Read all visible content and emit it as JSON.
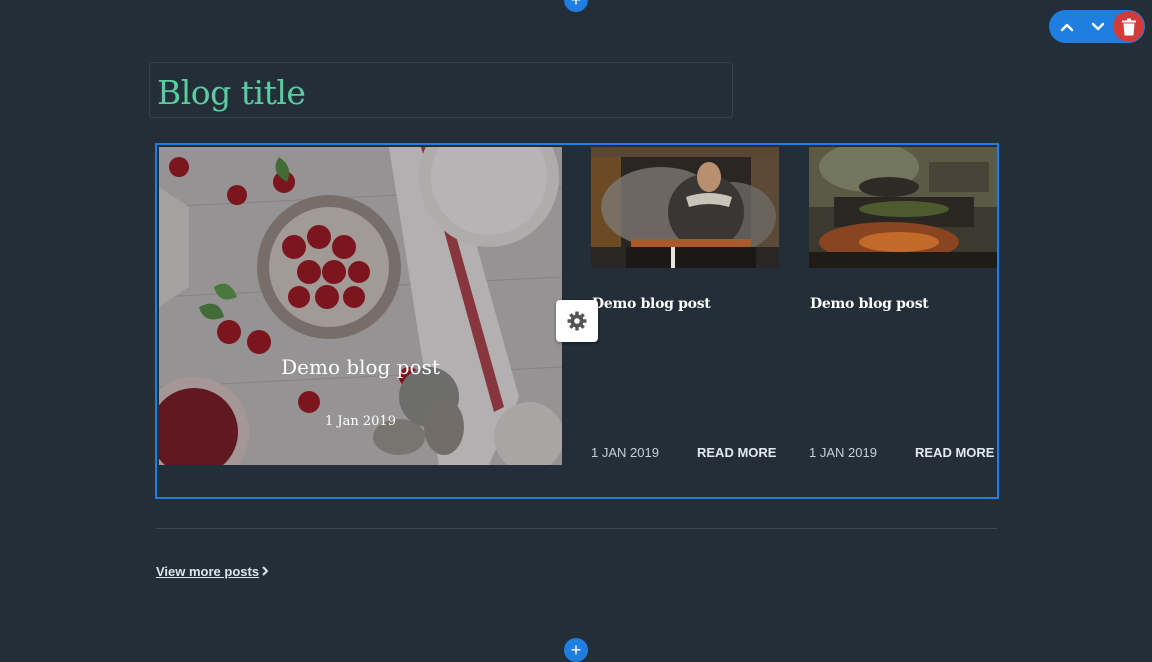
{
  "editor": {
    "add_section_symbol": "+",
    "controls": {
      "move_up_icon": "chevron-up-icon",
      "move_down_icon": "chevron-down-icon",
      "delete_icon": "trash-icon"
    },
    "accent_color": "#1e7fe0",
    "delete_color": "#d33b3b"
  },
  "blog": {
    "title": "Blog title",
    "title_color": "#5bcc9f",
    "featured_post": {
      "title": "Demo blog post",
      "date": "1 Jan 2019"
    },
    "posts": [
      {
        "title": "Demo blog post",
        "date": "1 JAN 2019",
        "read_more": "READ MORE"
      },
      {
        "title": "Demo blog post",
        "date": "1 JAN 2019",
        "read_more": "READ MORE"
      }
    ],
    "view_more": "View more posts"
  }
}
